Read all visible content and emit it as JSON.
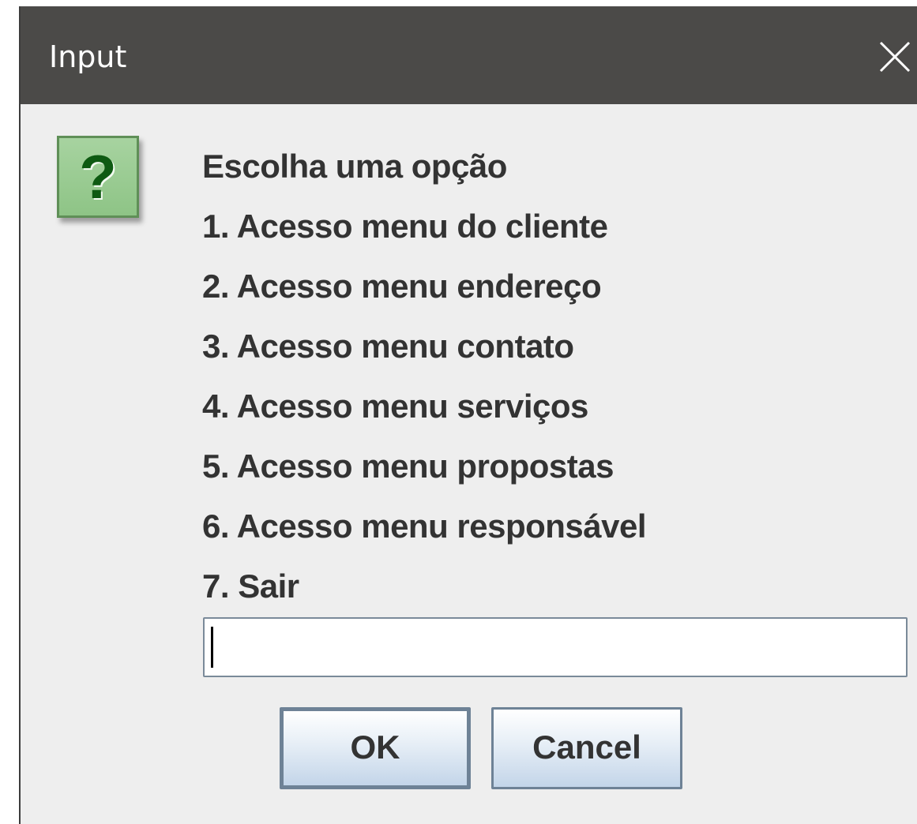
{
  "window": {
    "title": "Input",
    "close_icon": "close-icon"
  },
  "dialog": {
    "icon": "question-icon",
    "icon_glyph": "?",
    "message_lines": [
      "Escolha uma opção",
      "1. Acesso menu do cliente",
      "2. Acesso menu endereço",
      "3. Acesso menu contato",
      "4. Acesso menu serviços",
      "5. Acesso menu propostas",
      "6. Acesso menu responsável",
      "7. Sair"
    ],
    "input_value": "",
    "buttons": {
      "ok_label": "OK",
      "cancel_label": "Cancel"
    }
  },
  "colors": {
    "titlebar_bg": "#4b4a48",
    "dialog_bg": "#eeeeee",
    "icon_green": "#8ec486",
    "button_border": "#6e8296"
  }
}
